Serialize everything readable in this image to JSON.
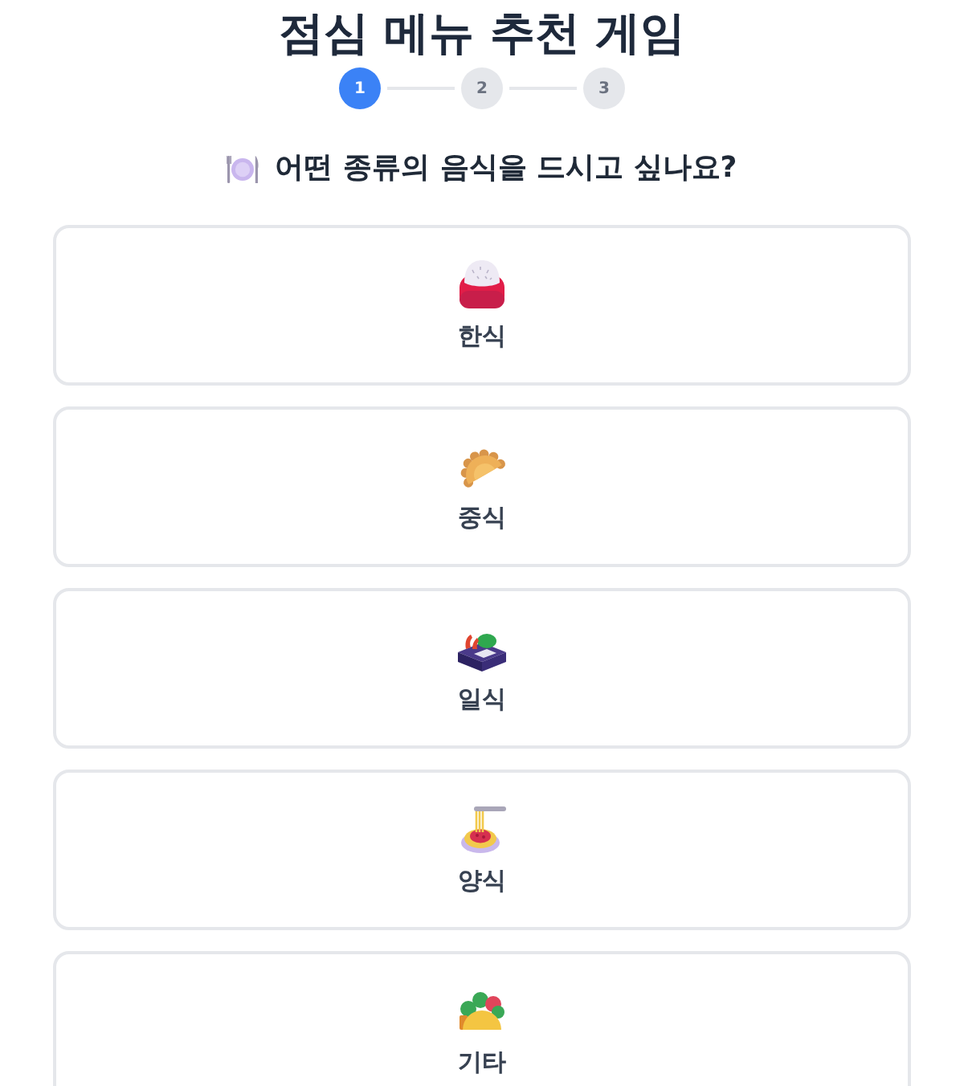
{
  "title": "점심 메뉴 추천 게임",
  "steps": [
    {
      "label": "1",
      "selected": true
    },
    {
      "label": "2",
      "selected": false
    },
    {
      "label": "3",
      "selected": false
    }
  ],
  "question": {
    "text": "어떤 종류의 음식을 드시고 싶나요?"
  },
  "options": [
    {
      "kind": "rice",
      "label": "한식"
    },
    {
      "kind": "dumpling",
      "label": "중식"
    },
    {
      "kind": "bento",
      "label": "일식"
    },
    {
      "kind": "pasta",
      "label": "양식"
    },
    {
      "kind": "taco",
      "label": "기타"
    }
  ]
}
